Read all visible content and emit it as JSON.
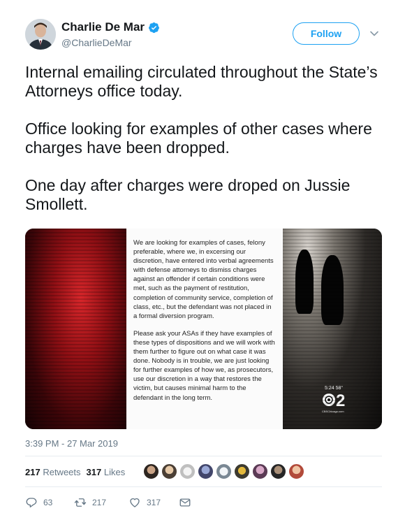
{
  "user": {
    "display_name": "Charlie De Mar",
    "handle": "@CharlieDeMar",
    "verified_icon": "verified-badge-icon"
  },
  "follow_label": "Follow",
  "tweet": {
    "paragraphs": [
      "Internal emailing circulated throughout the State’s Attorneys office today.",
      "Office looking for examples of other cases where charges have been dropped.",
      "One day after charges were droped on Jussie Smollett."
    ]
  },
  "media": {
    "memo_paragraphs": [
      "We are looking for examples of cases, felony preferable, where we, in excersing our discretion, have entered into verbal agreements with defense attorneys to dismiss charges against an offender if certain conditions were met, such as the payment of restitution, completion of community service, completion of class, etc., but the defendant was not placed in a formal diversion program.",
      "Please ask your ASAs if they have examples of these types of dispositions and we will work with them further to figure out on what case it was done. Nobody is in trouble, we are just looking for further examples of how we, as prosecutors, use our discretion in a way that restores the victim, but causes minimal harm to the defendant in the long term."
    ],
    "timecode": "5:24  58°",
    "logo_text": "2",
    "site_text": "CBSChicago.com"
  },
  "timestamp": "3:39 PM - 27 Mar 2019",
  "stats": {
    "retweets_count": "217",
    "retweets_label": "Retweets",
    "likes_count": "317",
    "likes_label": "Likes"
  },
  "actions": {
    "reply_count": "63",
    "retweet_count": "217",
    "like_count": "317"
  },
  "colors": {
    "accent": "#1da1f2",
    "muted": "#657786",
    "text": "#14171a"
  }
}
